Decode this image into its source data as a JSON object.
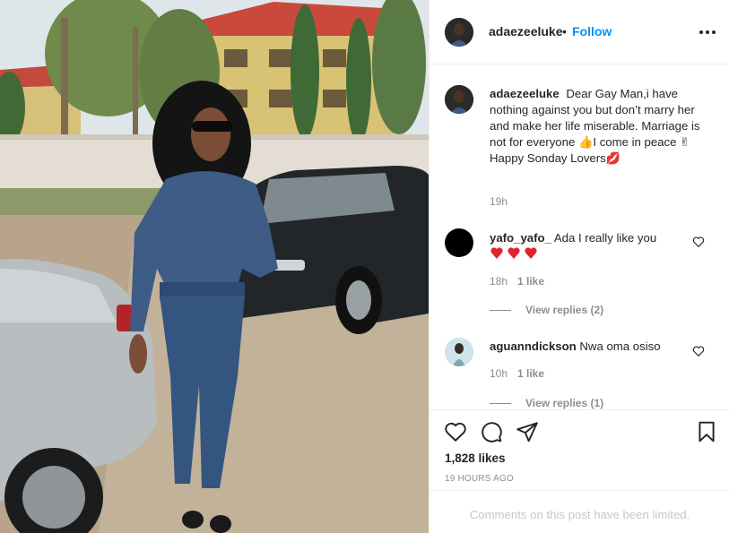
{
  "post": {
    "username": "adaezeeluke",
    "separator": "•",
    "follow_label": "Follow",
    "more_icon": "more-horizontal-icon"
  },
  "caption": {
    "username": "adaezeeluke",
    "text": "Dear Gay Man,i have nothing against you but don’t marry her and make her life miserable. Marriage is not for everyone 👍I come in peace ✌",
    "text_line2": "Happy Sonday Lovers💋",
    "time": "19h"
  },
  "comments": [
    {
      "username": "yafo_yafo_",
      "text": "Ada I really like you",
      "emoji": "❤❤❤",
      "time": "18h",
      "likes": "1 like",
      "view_replies": "View replies (2)"
    },
    {
      "username": "aguanndickson",
      "text": "Nwa oma osiso",
      "time": "10h",
      "likes": "1 like",
      "view_replies": "View replies (1)"
    }
  ],
  "actions": {
    "like_icon": "heart-icon",
    "comment_icon": "comment-icon",
    "share_icon": "paper-plane-icon",
    "save_icon": "bookmark-icon",
    "likes_count": "1,828 likes",
    "post_time": "19 HOURS AGO"
  },
  "footer": {
    "limited_text": "Comments on this post have been limited."
  },
  "colors": {
    "accent": "#0095f6",
    "text": "#262626",
    "muted": "#8e8e8e",
    "heart_red": "#ed4956"
  }
}
